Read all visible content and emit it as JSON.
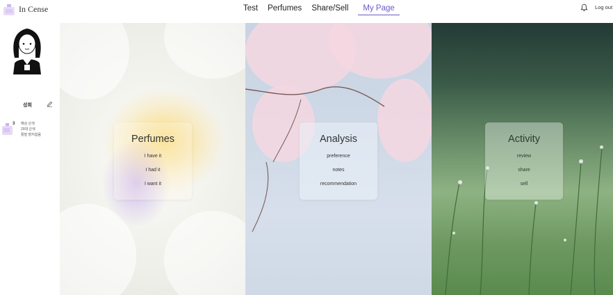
{
  "app": {
    "logo_text": "In Cense"
  },
  "nav": {
    "items": [
      {
        "label": "Test",
        "active": false
      },
      {
        "label": "Perfumes",
        "active": false
      },
      {
        "label": "Share/Sell",
        "active": false
      },
      {
        "label": "My Page",
        "active": true
      }
    ],
    "logout_label": "Log out",
    "icons": {
      "notification": "bell-icon"
    }
  },
  "sidebar": {
    "user_name": "성희",
    "edit_icon": "pencil-icon",
    "stats": {
      "count": "3",
      "lines": [
        "예상 곤색",
        "20대 곤색",
        "활발 밝지쉽음"
      ]
    }
  },
  "panels": [
    {
      "title": "Perfumes",
      "links": [
        "I have it",
        "I had it",
        "I want it"
      ]
    },
    {
      "title": "Analysis",
      "links": [
        "preference",
        "notes",
        "recommendation"
      ]
    },
    {
      "title": "Activity",
      "links": [
        "review",
        "share",
        "sell"
      ]
    }
  ],
  "colors": {
    "accent": "#6e58c8",
    "text": "#222222"
  }
}
